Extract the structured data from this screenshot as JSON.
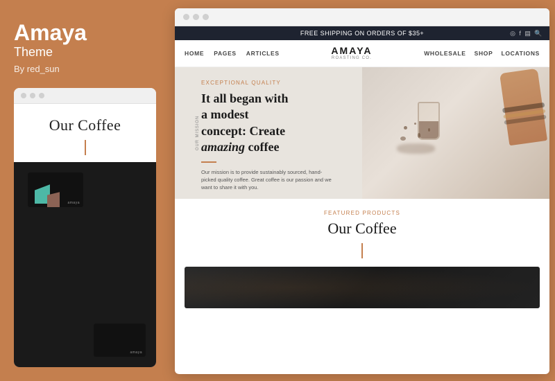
{
  "left": {
    "title": "Amaya",
    "subtitle": "Theme",
    "author": "By red_sun",
    "mini_preview": {
      "heading": "Our Coffee",
      "divider_color": "#c47f4e"
    }
  },
  "right": {
    "browser_dots": [
      "dot1",
      "dot2",
      "dot3"
    ],
    "announcement_bar": {
      "text": "FREE SHIPPING ON ORDERS OF $35+",
      "icons": [
        "instagram",
        "facebook",
        "search",
        "magnify"
      ]
    },
    "nav": {
      "items_left": [
        "HOME",
        "PAGES",
        "ARTICLES"
      ],
      "logo": {
        "main": "AMAYA",
        "sub": "ROASTING CO."
      },
      "items_right": [
        "WHOLESALE",
        "SHOP",
        "LOCATIONS"
      ]
    },
    "hero": {
      "side_label": "OUR MISSION",
      "tagline": "EXCEPTIONAL QUALITY",
      "heading_line1": "It all began with",
      "heading_line2": "a modest",
      "heading_line3": "concept: Create",
      "heading_line4_plain": "",
      "heading_line4_italic": "amazing",
      "heading_line4_rest": " coffee",
      "description": "Our mission is to provide sustainably sourced, hand-picked quality coffee. Great coffee is our passion and we want to share it with you."
    },
    "products": {
      "tagline": "FEATURED PRODUCTS",
      "heading": "Our Coffee"
    }
  }
}
